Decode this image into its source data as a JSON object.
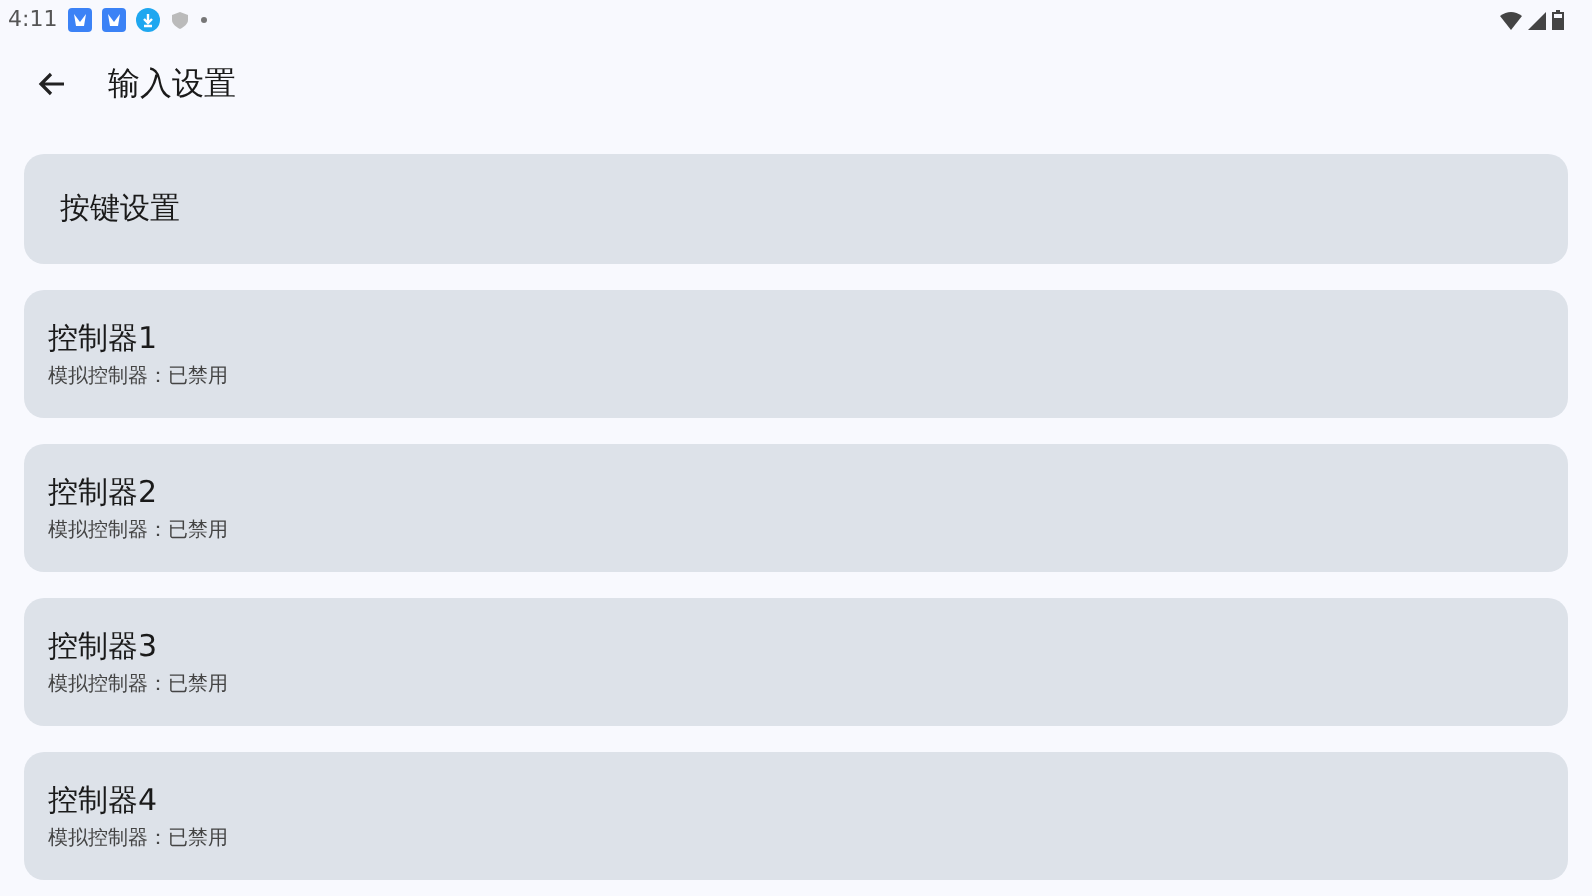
{
  "status_bar": {
    "time": "4:11"
  },
  "app_bar": {
    "title": "输入设置"
  },
  "header_card": {
    "label": "按键设置"
  },
  "controllers": [
    {
      "title": "控制器1",
      "subtitle": "模拟控制器：已禁用"
    },
    {
      "title": "控制器2",
      "subtitle": "模拟控制器：已禁用"
    },
    {
      "title": "控制器3",
      "subtitle": "模拟控制器：已禁用"
    },
    {
      "title": "控制器4",
      "subtitle": "模拟控制器：已禁用"
    }
  ]
}
